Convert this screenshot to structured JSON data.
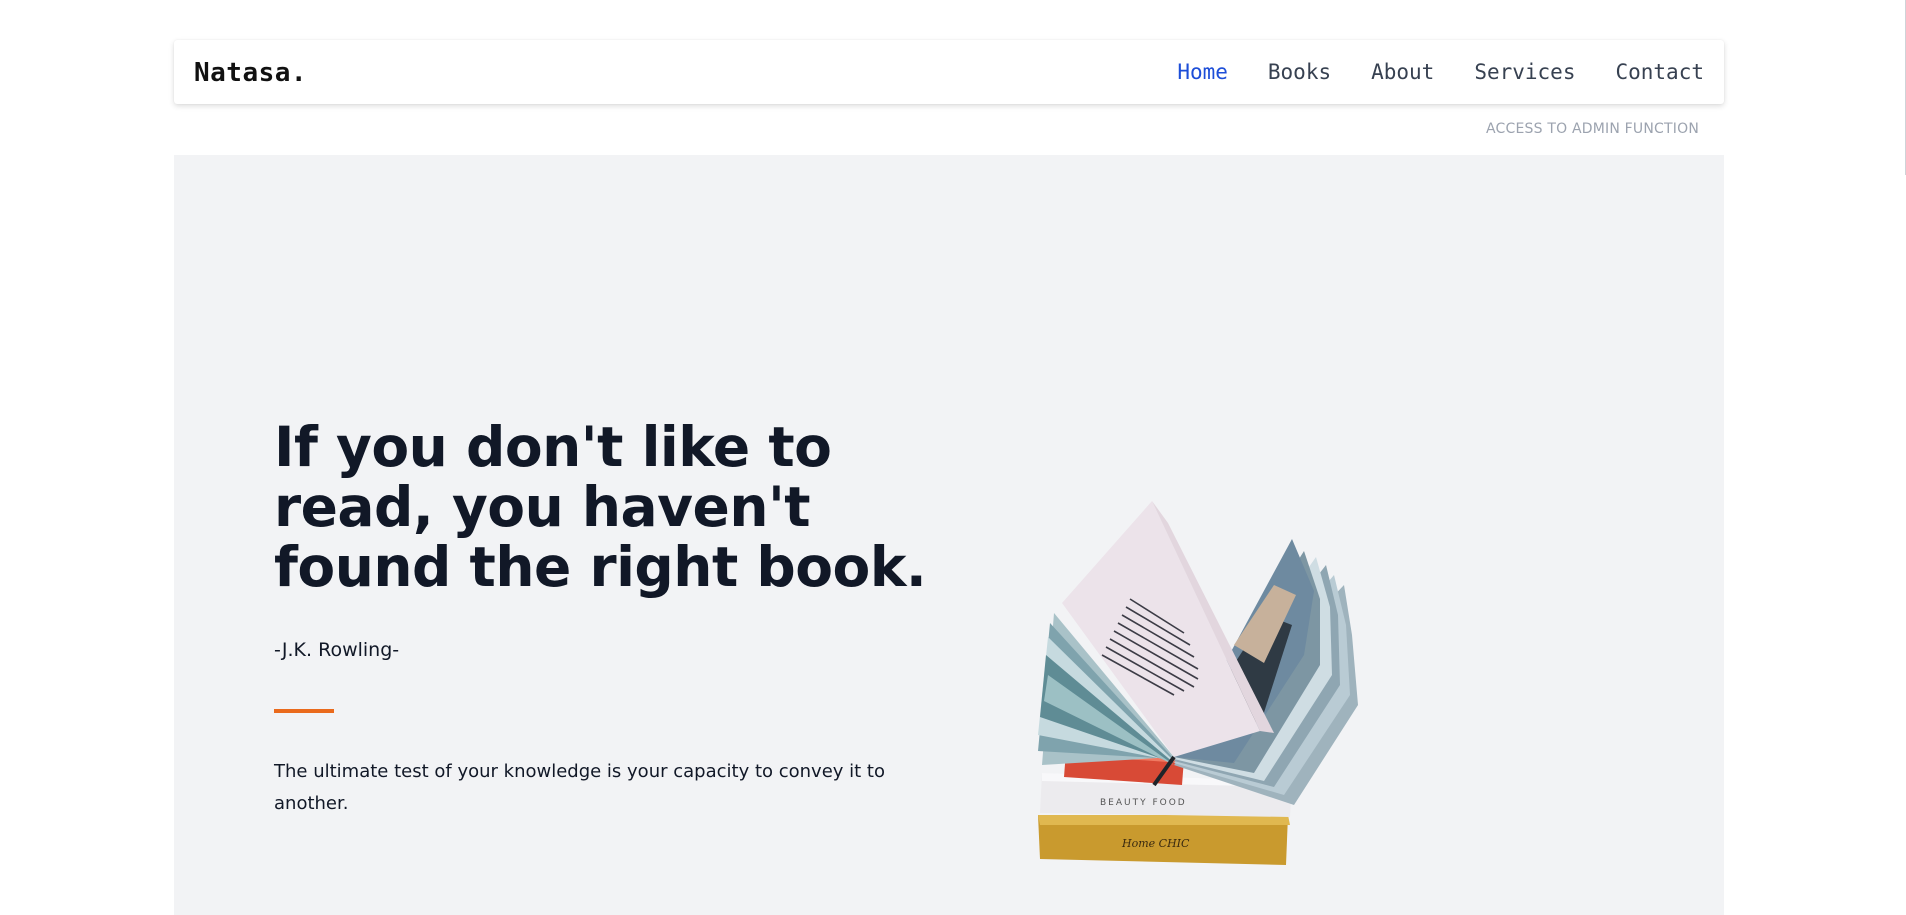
{
  "navbar": {
    "brand": "Natasa.",
    "links": [
      {
        "label": "Home",
        "active": true
      },
      {
        "label": "Books",
        "active": false
      },
      {
        "label": "About",
        "active": false
      },
      {
        "label": "Services",
        "active": false
      },
      {
        "label": "Contact",
        "active": false
      }
    ]
  },
  "admin_link": "ACCESS TO ADMIN FUNCTION",
  "hero": {
    "headline": "If you don't like to read, you haven't found the right book.",
    "author": "-J.K. Rowling-",
    "body": "The ultimate test of your knowledge is your capacity to convey it to another.",
    "image": {
      "description_icon": "open-book-stack-illustration",
      "book_spines": [
        "BEAUTY FOOD",
        "Home CHIC"
      ]
    }
  },
  "colors": {
    "page_background": "#ffffff",
    "hero_background": "#f2f3f5",
    "nav_active": "#1d4ed8",
    "nav_default": "#374151",
    "accent": "#ea6a1c",
    "heading": "#111827",
    "muted": "#9ca3af"
  }
}
